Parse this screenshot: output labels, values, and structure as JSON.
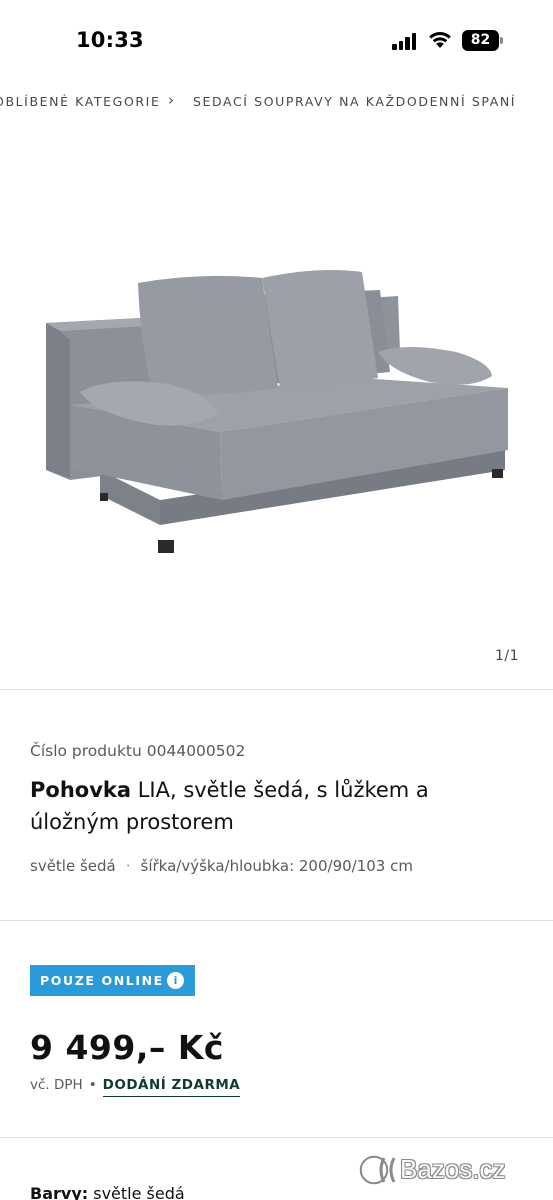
{
  "status_bar": {
    "time": "10:33",
    "battery": "82",
    "icons": [
      "signal-icon",
      "wifi-icon",
      "battery-icon"
    ]
  },
  "breadcrumb": {
    "items": [
      "OBLÍBENÉ KATEGORIE",
      "SEDACÍ SOUPRAVY NA KAŽDODENNÍ SPANÍ"
    ],
    "separator_icon": "chevron-right-icon"
  },
  "gallery": {
    "counter": "1/1"
  },
  "product": {
    "number": "Číslo produktu 0044000502",
    "name": "Pohovka",
    "description": " LIA, světle šedá, s lůžkem a úložným prostorem",
    "color_meta": "světle šedá",
    "dimensions": "šířka/výška/hloubka: 200/90/103 cm"
  },
  "badge": {
    "label": "POUZE ONLINE",
    "icon": "info-icon",
    "color": "#2b9ad8"
  },
  "pricing": {
    "price": "9 499,– Kč",
    "vat_note": "vč. DPH",
    "delivery": "DODÁNÍ ZDARMA"
  },
  "colors": {
    "label": "Barvy:",
    "value": " světle šedá"
  },
  "watermark": {
    "text": "Bazos.cz"
  }
}
